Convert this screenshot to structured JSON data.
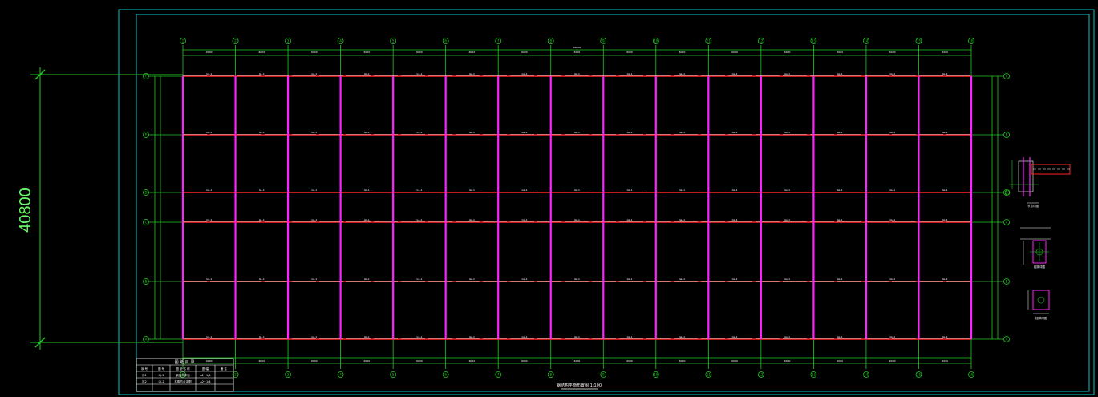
{
  "colors": {
    "background": "#000000",
    "frame": "#00c8c8",
    "axis": "#22cc22",
    "column": "#ff22ff",
    "beam": "#ff2222",
    "dim_text": "#66ff66",
    "white": "#ffffff"
  },
  "overall_dimension": {
    "text": "40800"
  },
  "title_table": {
    "header": "图 纸 目 录",
    "rows": [
      [
        "序 号",
        "图 号",
        "图 纸 名 称",
        "图 幅",
        "备 注"
      ],
      [
        "序1",
        "GJ-1",
        "钢结构平面",
        "A2+1/4",
        ""
      ],
      [
        "序2",
        "GJ-2",
        "柱脚节点详图",
        "A2+1/4",
        ""
      ]
    ]
  },
  "plan_title": "钢结构平面布置图 1:100",
  "grid": {
    "columns": [
      "1",
      "2",
      "3",
      "4",
      "5",
      "6",
      "7",
      "8",
      "9",
      "10",
      "11",
      "12",
      "13",
      "14",
      "15",
      "16"
    ],
    "rows": [
      "A",
      "B",
      "C",
      "D",
      "E",
      "F"
    ],
    "bay_label": "6000",
    "total_label": "96000",
    "beam_label": "GL-1"
  },
  "details": {
    "detail1_label": "节点详图",
    "detail2_label": "柱脚详图",
    "detail3_label": "柱脚详图"
  }
}
